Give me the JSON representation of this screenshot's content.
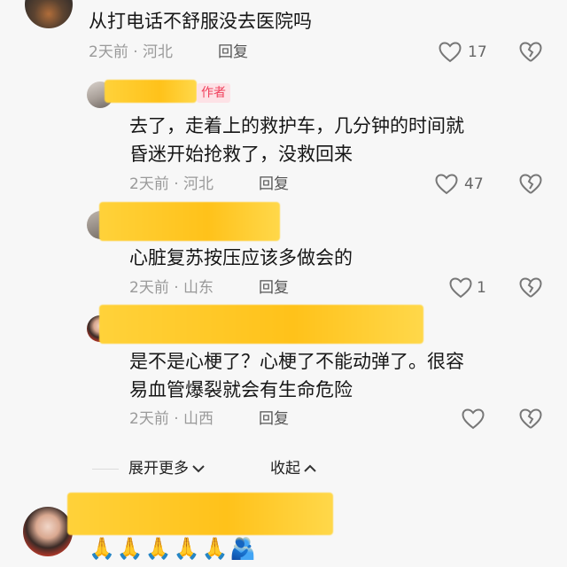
{
  "comments": [
    {
      "text": "从打电话不舒服没去医院吗",
      "meta": "2天前 · 河北",
      "reply": "回复",
      "likes": "17"
    },
    {
      "badge": "作者",
      "text_line1": "去了，走着上的救护车，几分钟的时间就",
      "text_line2": "昏迷开始抢救了，没救回来",
      "meta": "2天前 · 河北",
      "reply": "回复",
      "likes": "47"
    },
    {
      "text": "心脏复苏按压应该多做会的",
      "meta": "2天前 · 山东",
      "reply": "回复",
      "likes": "1"
    },
    {
      "text_line1": "是不是心梗了？心梗了不能动弹了。很容",
      "text_line2": "易血管爆裂就会有生命危险",
      "meta": "2天前 · 山西",
      "reply": "回复",
      "likes": ""
    }
  ],
  "controls": {
    "expand_more": "展开更多",
    "collapse": "收起"
  },
  "last_comment": {
    "emojis": "🙏🙏🙏🙏🙏🫂"
  },
  "colors": {
    "background": "#f7f7f7",
    "author_badge": "#f0405c",
    "redacted": "#ffc21a",
    "meta_text": "#9a9a9a"
  },
  "icons": [
    "heart-icon",
    "broken-heart-icon",
    "chevron-down-icon",
    "chevron-up-icon"
  ]
}
